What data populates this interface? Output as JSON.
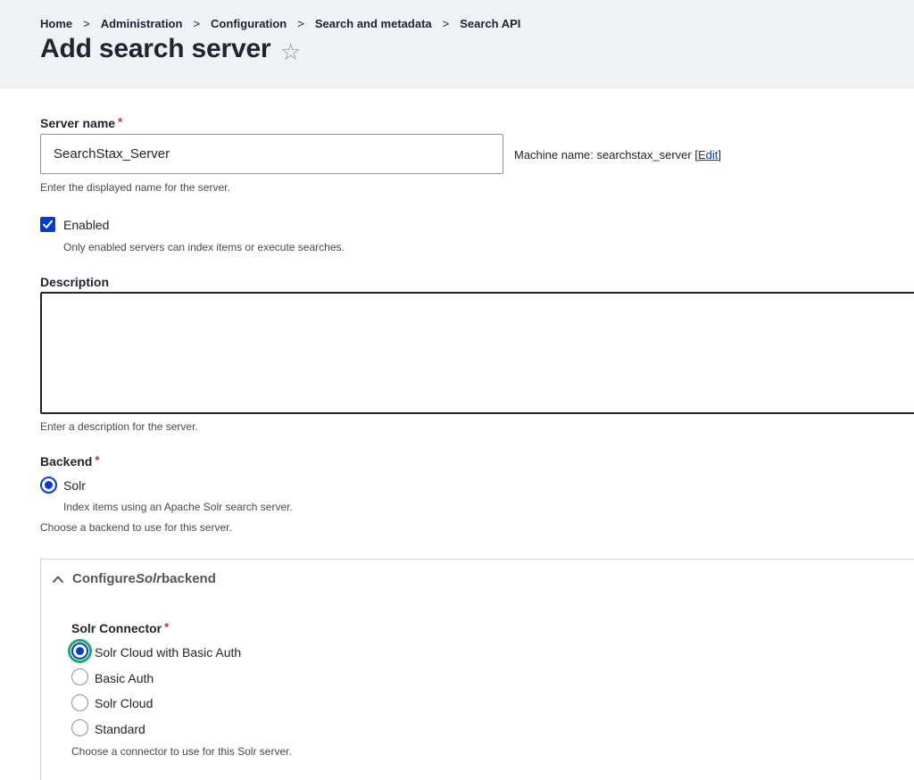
{
  "breadcrumb": [
    "Home",
    "Administration",
    "Configuration",
    "Search and metadata",
    "Search API"
  ],
  "breadcrumb_separator": ">",
  "page_title": "Add search server",
  "icons": {
    "favorite": "star-icon",
    "collapse": "chevron-up-icon",
    "check": "checkmark-icon"
  },
  "colors": {
    "accent": "#003ecc",
    "required": "#dc2323",
    "focus": "#26a769",
    "header_bg": "#f0f1f5"
  },
  "server_name": {
    "label": "Server name",
    "required": "*",
    "value": "SearchStax_Server",
    "machine_prefix": "Machine name: searchstax_server [",
    "machine_edit": "Edit",
    "machine_suffix": "]",
    "help": "Enter the displayed name for the server."
  },
  "enabled": {
    "label": "Enabled",
    "checked": true,
    "help": "Only enabled servers can index items or execute searches."
  },
  "description": {
    "label": "Description",
    "value": "",
    "help": "Enter a description for the server."
  },
  "backend": {
    "label": "Backend",
    "required": "*",
    "option": "Solr",
    "option_help": "Index items using an Apache Solr search server.",
    "help": "Choose a backend to use for this server."
  },
  "solr_details": {
    "title_pre": "Configure ",
    "title_em": "Solr",
    "title_post": " backend",
    "connector_label": "Solr Connector",
    "required": "*",
    "options": [
      "Solr Cloud with Basic Auth",
      "Basic Auth",
      "Solr Cloud",
      "Standard"
    ],
    "selected": "Solr Cloud with Basic Auth",
    "help": "Choose a connector to use for this Solr server."
  }
}
